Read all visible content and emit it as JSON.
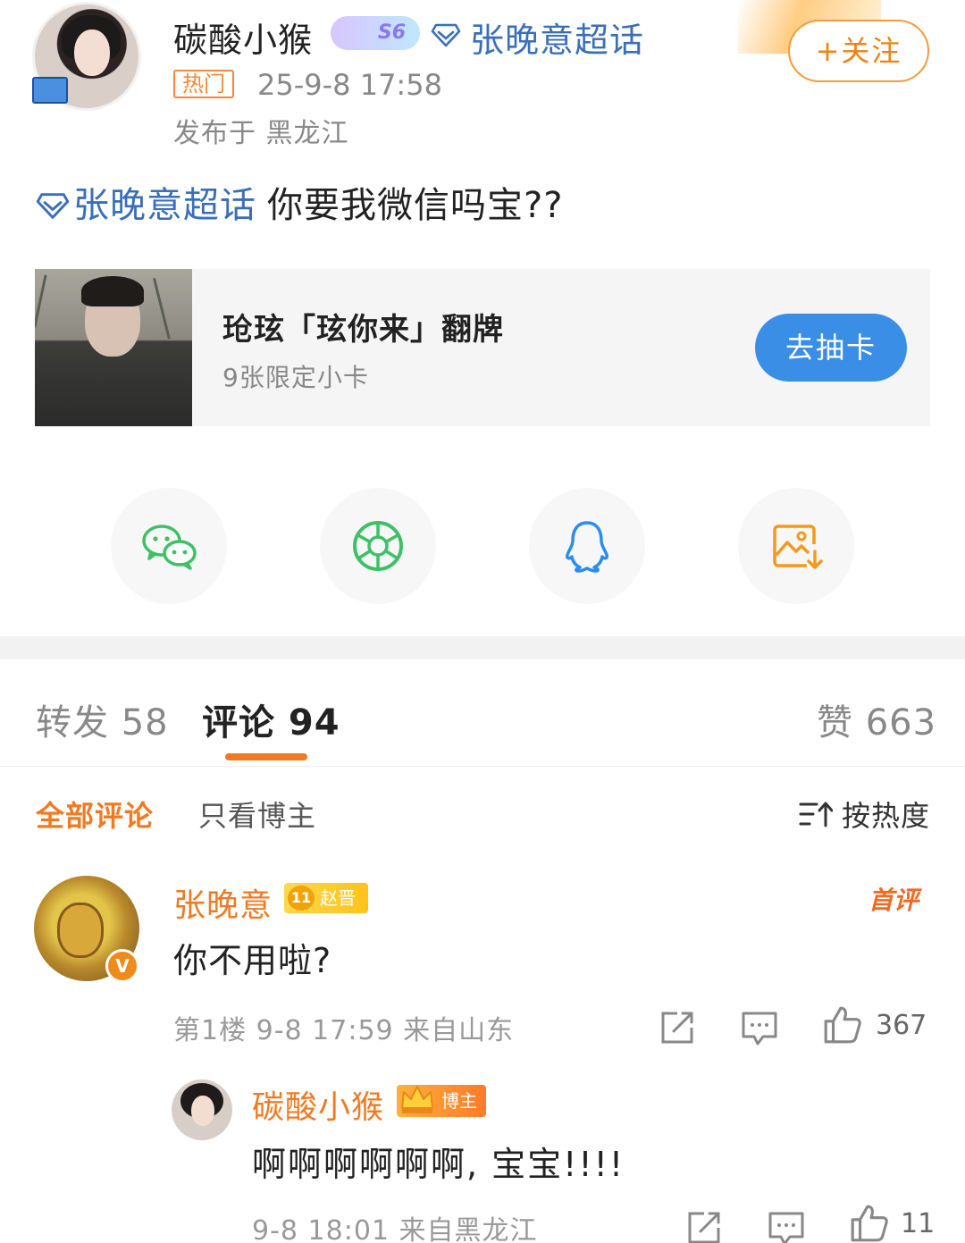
{
  "post": {
    "author_name": "碳酸小猴",
    "level_badge": "S6",
    "supertopic": "张晚意超话",
    "hot_tag": "热门",
    "time": "25-9-8 17:58",
    "location": "发布于 黑龙江",
    "follow_label": "+关注",
    "topic_link": "张晚意超话",
    "body_text": "你要我微信吗宝??"
  },
  "card": {
    "title": "玱玹「玹你来」翻牌",
    "subtitle": "9张限定小卡",
    "button_label": "去抽卡"
  },
  "share": {
    "items": [
      {
        "icon": "wechat-icon",
        "color": "#3fc067"
      },
      {
        "icon": "moments-icon",
        "color": "#3fc067"
      },
      {
        "icon": "qq-icon",
        "color": "#2a8ef0"
      },
      {
        "icon": "save-image-icon",
        "color": "#f39a1e"
      }
    ]
  },
  "tabs": {
    "repost": "转发 58",
    "comments": "评论 94",
    "likes": "赞 663",
    "active": "comments"
  },
  "filters": {
    "all": "全部评论",
    "author_only": "只看博主",
    "sort": "按热度"
  },
  "comment": {
    "name": "张晚意",
    "badge_level": "11",
    "badge_text": "赵晋",
    "tag": "首评",
    "text": "你不用啦?",
    "meta": "第1楼 9-8 17:59 来自山东",
    "likes": "367"
  },
  "reply": {
    "name": "碳酸小猴",
    "badge_text": "博主",
    "text": "啊啊啊啊啊啊, 宝宝!!!!",
    "meta": "9-8 18:01 来自黑龙江",
    "likes": "11"
  },
  "colors": {
    "accent_orange": "#f07a22",
    "link_blue": "#3a6fb8",
    "button_blue": "#3a8ee6"
  }
}
